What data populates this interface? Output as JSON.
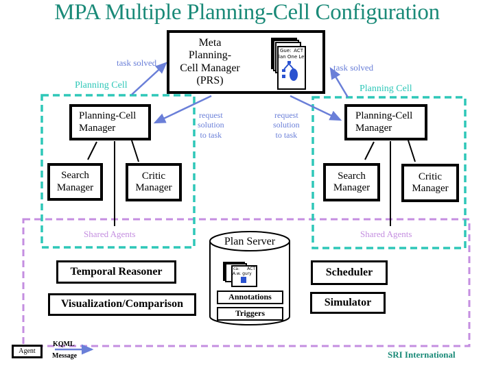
{
  "title": "MPA Multiple Planning-Cell Configuration",
  "meta_manager": {
    "label_line1": "Meta Planning-",
    "label_line2": "Cell Manager",
    "label_line3": "(PRS)",
    "doc_header_left": "Gue:",
    "doc_header_right": "ACT",
    "doc_subtitle": "lan One Level"
  },
  "arrows": {
    "task_solved_left": "task solved",
    "task_solved_right": "task solved",
    "request_left": [
      "request",
      "solution",
      "to task"
    ],
    "request_right": [
      "request",
      "solution",
      "to task"
    ]
  },
  "planning_cells": [
    {
      "label": "Planning Cell",
      "manager": [
        "Planning-Cell",
        "Manager"
      ],
      "search": [
        "Search",
        "Manager"
      ],
      "critic": [
        "Critic",
        "Manager"
      ]
    },
    {
      "label": "Planning Cell",
      "manager": [
        "Planning-Cell",
        "Manager"
      ],
      "search": [
        "Search",
        "Manager"
      ],
      "critic": [
        "Critic",
        "Manager"
      ]
    }
  ],
  "shared_agents": {
    "label_left": "Shared Agents",
    "label_right": "Shared Agents",
    "temporal_reasoner": "Temporal Reasoner",
    "visualization": "Visualization/Comparison",
    "scheduler": "Scheduler",
    "simulator": "Simulator"
  },
  "plan_server": {
    "label": "Plan Server",
    "doc_header_left": "ca:",
    "doc_header_right": "ACT",
    "doc_subtitle": "A.w. gury",
    "annotations": "Annotations",
    "triggers": "Triggers"
  },
  "legend": {
    "agent": "Agent",
    "kqml_line1": "KQML",
    "kqml_line2": "Message"
  },
  "footer": "SRI International",
  "colors": {
    "title": "#1a8a78",
    "planning_cell": "#2ec7b8",
    "shared_agents": "#c48ee0",
    "message_arrow": "#6a7fd8",
    "footer": "#1a8a78"
  }
}
